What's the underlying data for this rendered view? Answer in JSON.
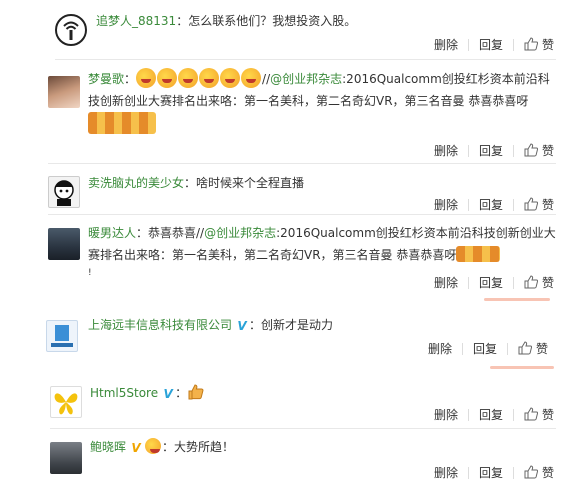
{
  "actions": {
    "delete": "删除",
    "reply": "回复",
    "like": "赞"
  },
  "comments": [
    {
      "user": "追梦人_88131",
      "text": "：怎么联系他们？我想投资入股。"
    },
    {
      "user": "梦曼歌",
      "line1_suffix": "//",
      "mention": "@创业邦杂志",
      "line1_rest": ":2016Qualcomm创投红杉资本前沿科",
      "line2": "技创新创业大赛排名出来咯：第一名美科，第二名奇幻VR，第三名音曼 恭喜恭喜呀"
    },
    {
      "user": "卖洗脑丸的美少女",
      "text": "：啥时候来个全程直播"
    },
    {
      "user": "暖男达人",
      "line1_prefix": "：恭喜恭喜//",
      "mention": "@创业邦杂志",
      "line1_rest": ":2016Qualcomm创投红杉资本前沿科技创新创业大",
      "line2": "赛排名出来咯：第一名美科，第二名奇幻VR，第三名音曼 恭喜恭喜呀",
      "line3": "!"
    },
    {
      "user": "上海远丰信息科技有限公司",
      "text": "：创新才是动力"
    },
    {
      "user": "Html5Store",
      "text": "："
    },
    {
      "user": "鲍晓晖",
      "text": "：大势所趋！"
    }
  ]
}
